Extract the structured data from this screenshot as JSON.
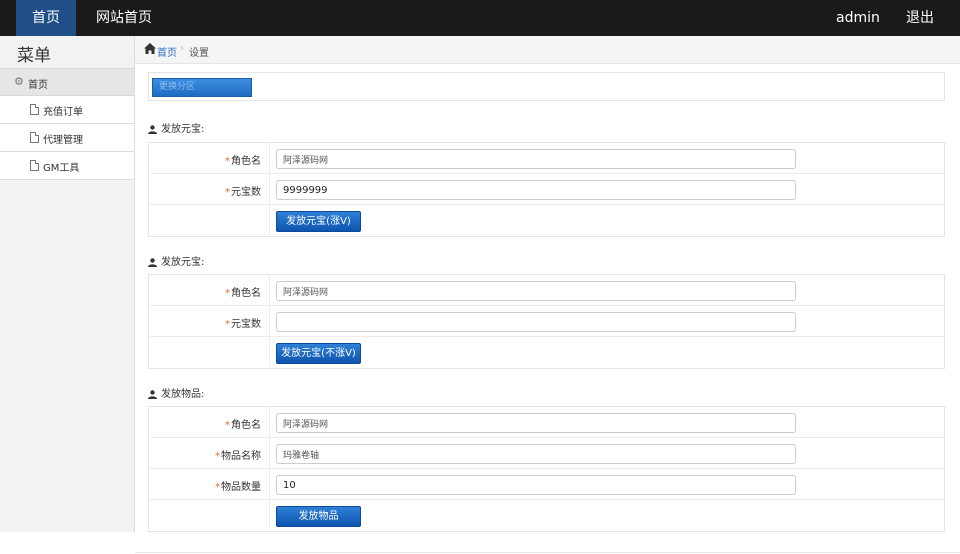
{
  "topbar": {
    "home": "首页",
    "site_home": "网站首页",
    "user": "admin",
    "logout": "退出"
  },
  "sidebar": {
    "title": "菜单",
    "group": "首页",
    "items": [
      {
        "label": "充值订单"
      },
      {
        "label": "代理管理"
      },
      {
        "label": "GM工具"
      }
    ]
  },
  "breadcrumb": {
    "home": "首页",
    "separator": "›",
    "current": "设置"
  },
  "zone": {
    "button": "更换分区"
  },
  "sections": [
    {
      "title": "发放元宝:",
      "fields": [
        {
          "label": "角色名",
          "value": "阿泽源码网"
        },
        {
          "label": "元宝数",
          "value": "9999999"
        }
      ],
      "button": "发放元宝(涨V)"
    },
    {
      "title": "发放元宝:",
      "fields": [
        {
          "label": "角色名",
          "value": "阿泽源码网"
        },
        {
          "label": "元宝数",
          "value": ""
        }
      ],
      "button": "发放元宝(不涨V)"
    },
    {
      "title": "发放物品:",
      "fields": [
        {
          "label": "角色名",
          "value": "阿泽源码网"
        },
        {
          "label": "物品名称",
          "value": "玛雅卷轴"
        },
        {
          "label": "物品数量",
          "value": "10"
        }
      ],
      "button": "发放物品"
    }
  ],
  "required_mark": "*",
  "colors": {
    "topbar_bg": "#1a1a1a",
    "active_nav": "#1f4f86",
    "button_blue": "#1e6cc2",
    "required_star": "#e36c2f",
    "link": "#2a6ebb"
  }
}
